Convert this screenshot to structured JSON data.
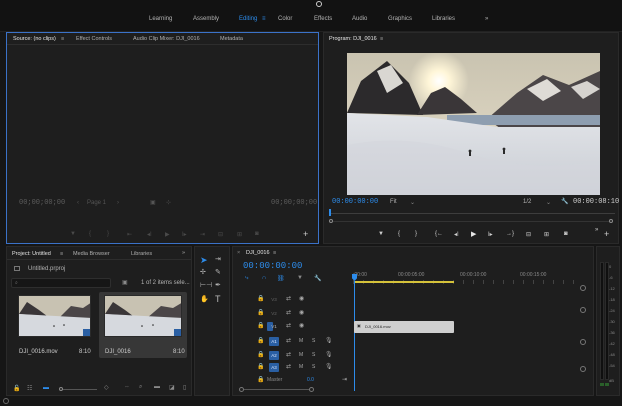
{
  "workspaces": [
    {
      "label": "Learning"
    },
    {
      "label": "Assembly"
    },
    {
      "label": "Editing",
      "active": true
    },
    {
      "label": "Color"
    },
    {
      "label": "Effects"
    },
    {
      "label": "Audio"
    },
    {
      "label": "Graphics"
    },
    {
      "label": "Libraries"
    },
    {
      "label": "»"
    }
  ],
  "source_panel": {
    "tabs": [
      "Source: (no clips)",
      "Effect Controls",
      "Audio Clip Mixer: DJI_0016",
      "Metadata"
    ],
    "timecode_left": "00;00;00;00",
    "page": "Page 1",
    "timecode_right": "00;00;00;00"
  },
  "program_panel": {
    "title": "Program: DJI_0016",
    "timecode": "00:00:00:00",
    "fit": "Fit",
    "resolution": "1/2",
    "duration": "00:00:08:10"
  },
  "project_panel": {
    "tabs": [
      "Project: Untitled",
      "Media Browser",
      "Libraries",
      "»"
    ],
    "project_name": "Untitled.prproj",
    "items_count": "1 of 2 items sele...",
    "items": [
      {
        "name": "DJI_0016.mov",
        "duration": "8:10"
      },
      {
        "name": "DJI_0016",
        "duration": "8:10"
      }
    ]
  },
  "timeline": {
    "title": "DJI_0016",
    "timecode": "00:00:00:00",
    "ruler": [
      ":00:00",
      "00:00:05:00",
      "00:00:10:00",
      "00:00:15:00"
    ],
    "video_tracks": [
      "V3",
      "V2",
      "V1"
    ],
    "audio_tracks": [
      "A1",
      "A2",
      "A3"
    ],
    "clip_name": "DJI_0016.mov",
    "master_label": "Master",
    "master_value": "0.0",
    "mute": "M",
    "solo": "S"
  },
  "meter_labels": [
    "0",
    "-6",
    "-12",
    "-18",
    "-24",
    "-30",
    "-36",
    "-42",
    "-48",
    "-54",
    "dB"
  ],
  "colors": {
    "accent": "#2d8ceb",
    "clip": "#d2d2d2",
    "playhead": "#2d8ceb"
  }
}
